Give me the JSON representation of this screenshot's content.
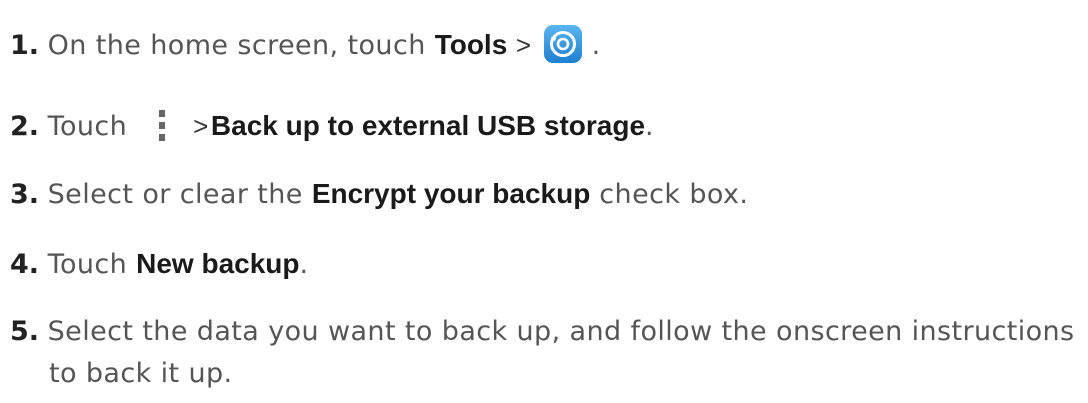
{
  "steps": [
    {
      "number": "1.",
      "text_before": "On the home screen, touch ",
      "bold": "Tools",
      "separator": ">",
      "icon": "backup-app-icon",
      "text_after": "."
    },
    {
      "number": "2.",
      "text_before": "Touch",
      "icon": "more-options-icon",
      "separator": ">",
      "bold": "Back up to external USB storage",
      "text_after": "."
    },
    {
      "number": "3.",
      "text_before": "Select or clear the ",
      "bold": "Encrypt your backup",
      "text_after": " check box."
    },
    {
      "number": "4.",
      "text_before": "Touch ",
      "bold": "New backup",
      "text_after": "."
    },
    {
      "number": "5.",
      "text_line1": "Select the data you want to back up, and follow the onscreen instructions",
      "text_line2": "to back it up."
    }
  ],
  "colors": {
    "text": "#555555",
    "bold": "#1a1a1a",
    "icon_blue": "#2f8fd8"
  }
}
